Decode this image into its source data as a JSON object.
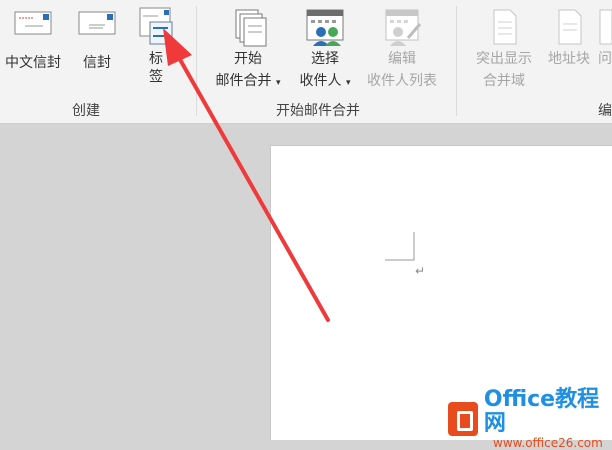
{
  "ribbon": {
    "groups": [
      {
        "label": "创建",
        "buttons": [
          {
            "label": "中文信封"
          },
          {
            "label": "信封"
          },
          {
            "label_line1": "标",
            "label_line2": "签"
          }
        ]
      },
      {
        "label": "开始邮件合并",
        "buttons": [
          {
            "label_line1": "开始",
            "label_line2": "邮件合并"
          },
          {
            "label_line1": "选择",
            "label_line2": "收件人"
          },
          {
            "label_line1": "编辑",
            "label_line2": "收件人列表"
          }
        ]
      },
      {
        "label": "编",
        "buttons": [
          {
            "label_line1": "突出显示",
            "label_line2": "合并域"
          },
          {
            "label": "地址块"
          },
          {
            "label": "问"
          }
        ]
      }
    ]
  },
  "document": {
    "paragraph_mark": "↵"
  },
  "watermark": {
    "brand": "Office教程网",
    "url": "www.office26.com"
  },
  "colors": {
    "annotation_arrow": "#f0393a",
    "watermark_blue": "#1e8fe3",
    "watermark_orange": "#e84c1e"
  }
}
